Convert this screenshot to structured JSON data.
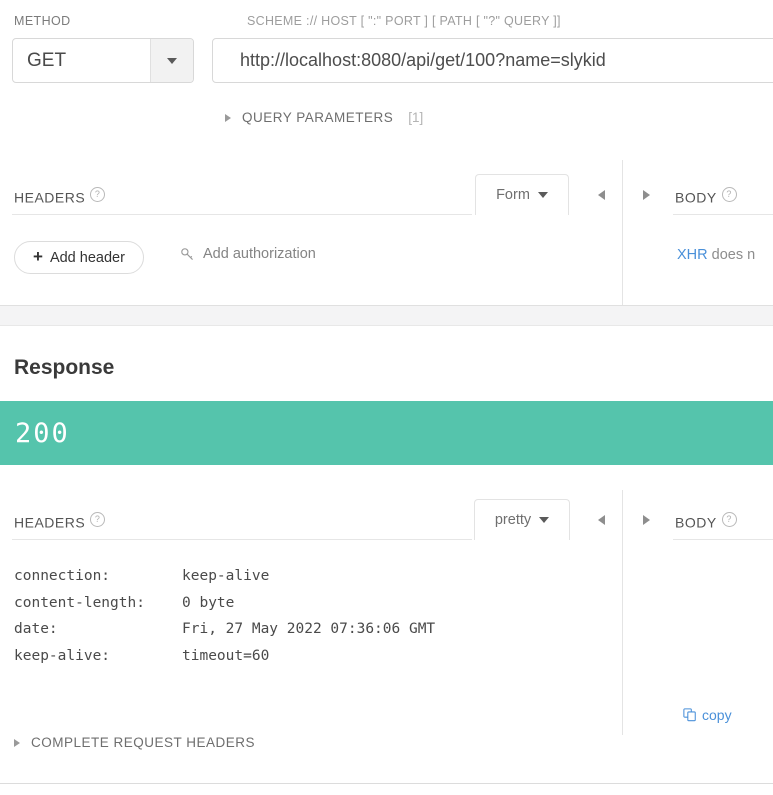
{
  "request": {
    "method_label": "METHOD",
    "method_value": "GET",
    "url_label": "SCHEME :// HOST [ \":\" PORT ] [ PATH [ \"?\" QUERY ]]",
    "url_value": "http://localhost:8080/api/get/100?name=slykid",
    "query_parameters": {
      "label": "QUERY PARAMETERS",
      "count": "[1]"
    },
    "headers_section": {
      "title": "HEADERS",
      "help": "?",
      "mode": "Form",
      "add_header_label": "Add header",
      "add_header_plus": "+",
      "add_authorization_label": "Add authorization"
    },
    "body_section": {
      "title": "BODY",
      "help": "?",
      "note_link": "XHR",
      "note_rest": " does n"
    }
  },
  "response": {
    "title": "Response",
    "status_code": "200",
    "status_color": "#55c4ac",
    "headers_section": {
      "title": "HEADERS",
      "help": "?",
      "mode": "pretty",
      "rows": [
        {
          "key": "connection:",
          "value": "keep-alive"
        },
        {
          "key": "content-length:",
          "value": "0 byte"
        },
        {
          "key": "date:",
          "value": "Fri, 27 May 2022 07:36:06 GMT"
        },
        {
          "key": "keep-alive:",
          "value": "timeout=60"
        }
      ]
    },
    "body_section": {
      "title": "BODY",
      "help": "?",
      "copy_label": "copy"
    },
    "complete_request_headers": "COMPLETE REQUEST HEADERS"
  }
}
